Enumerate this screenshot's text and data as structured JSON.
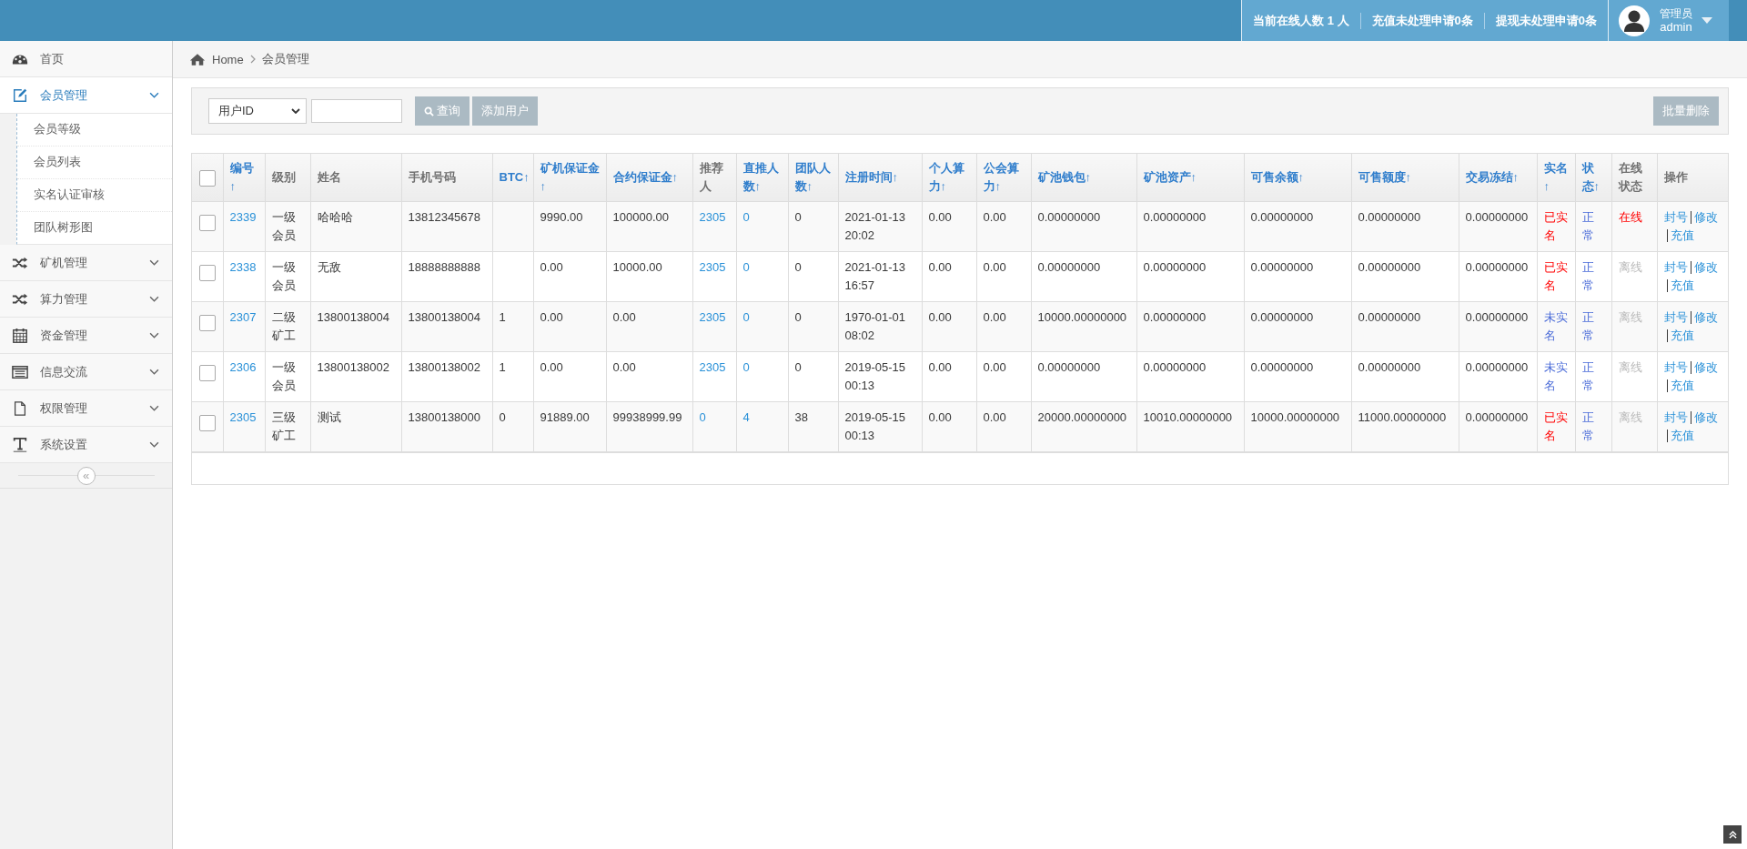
{
  "topbar": {
    "stats": [
      "当前在线人数 1 人",
      "充值未处理申请0条",
      "提现未处理申请0条"
    ],
    "user": {
      "role": "管理员",
      "name": "admin"
    }
  },
  "sidebar": {
    "items": [
      {
        "label": "首页"
      },
      {
        "label": "会员管理",
        "expanded": true,
        "children": [
          {
            "label": "会员等级"
          },
          {
            "label": "会员列表"
          },
          {
            "label": "实名认证审核"
          },
          {
            "label": "团队树形图"
          }
        ]
      },
      {
        "label": "矿机管理",
        "expanded": false
      },
      {
        "label": "算力管理",
        "expanded": false
      },
      {
        "label": "资金管理",
        "expanded": false
      },
      {
        "label": "信息交流",
        "expanded": false
      },
      {
        "label": "权限管理",
        "expanded": false
      },
      {
        "label": "系统设置",
        "expanded": false
      }
    ],
    "collapse": "«"
  },
  "breadcrumb": [
    "Home",
    "会员管理"
  ],
  "toolbar": {
    "filter": "用户ID",
    "search": "查询",
    "add": "添加用户",
    "bulk_delete": "批量删除"
  },
  "table": {
    "select_all_checked": false,
    "columns": [
      {
        "label": "编号↑",
        "sortable": true
      },
      {
        "label": "级别",
        "sortable": false
      },
      {
        "label": "姓名",
        "sortable": false
      },
      {
        "label": "手机号码",
        "sortable": false
      },
      {
        "label": "BTC↑",
        "sortable": true
      },
      {
        "label": "矿机保证金↑",
        "sortable": true
      },
      {
        "label": "合约保证金↑",
        "sortable": true
      },
      {
        "label": "推荐人",
        "sortable": false
      },
      {
        "label": "直推人数↑",
        "sortable": true
      },
      {
        "label": "团队人数↑",
        "sortable": true
      },
      {
        "label": "注册时间↑",
        "sortable": true
      },
      {
        "label": "个人算力↑",
        "sortable": true
      },
      {
        "label": "公会算力↑",
        "sortable": true
      },
      {
        "label": "矿池钱包↑",
        "sortable": true
      },
      {
        "label": "矿池资产↑",
        "sortable": true
      },
      {
        "label": "可售余额↑",
        "sortable": true
      },
      {
        "label": "可售额度↑",
        "sortable": true
      },
      {
        "label": "交易冻结↑",
        "sortable": true
      },
      {
        "label": "实名↑",
        "sortable": true
      },
      {
        "label": "状态↑",
        "sortable": true
      },
      {
        "label": "在线状态",
        "sortable": false
      },
      {
        "label": "操作",
        "sortable": false
      }
    ],
    "rows": [
      {
        "checked": false,
        "cells": [
          {
            "text": "2339",
            "kind": "link"
          },
          {
            "text": "一级会员",
            "kind": "text"
          },
          {
            "text": "哈哈哈",
            "kind": "text"
          },
          {
            "text": "13812345678",
            "kind": "text"
          },
          {
            "text": "",
            "kind": "text"
          },
          {
            "text": "9990.00",
            "kind": "text"
          },
          {
            "text": "100000.00",
            "kind": "text"
          },
          {
            "text": "2305",
            "kind": "link"
          },
          {
            "text": "0",
            "kind": "link"
          },
          {
            "text": "0",
            "kind": "text"
          },
          {
            "text": "2021-01-13 20:02",
            "kind": "text"
          },
          {
            "text": "0.00",
            "kind": "text"
          },
          {
            "text": "0.00",
            "kind": "text"
          },
          {
            "text": "0.00000000",
            "kind": "text"
          },
          {
            "text": "0.00000000",
            "kind": "text"
          },
          {
            "text": "0.00000000",
            "kind": "text"
          },
          {
            "text": "0.00000000",
            "kind": "text"
          },
          {
            "text": "0.00000000",
            "kind": "text"
          },
          {
            "text": "已实名",
            "kind": "alert"
          },
          {
            "text": "正常",
            "kind": "info"
          },
          {
            "text": "在线",
            "kind": "alert"
          }
        ],
        "actions": [
          "封号",
          "修改",
          "充值"
        ]
      },
      {
        "checked": false,
        "cells": [
          {
            "text": "2338",
            "kind": "link"
          },
          {
            "text": "一级会员",
            "kind": "text"
          },
          {
            "text": "无敌",
            "kind": "text"
          },
          {
            "text": "18888888888",
            "kind": "text"
          },
          {
            "text": "",
            "kind": "text"
          },
          {
            "text": "0.00",
            "kind": "text"
          },
          {
            "text": "10000.00",
            "kind": "text"
          },
          {
            "text": "2305",
            "kind": "link"
          },
          {
            "text": "0",
            "kind": "link"
          },
          {
            "text": "0",
            "kind": "text"
          },
          {
            "text": "2021-01-13 16:57",
            "kind": "text"
          },
          {
            "text": "0.00",
            "kind": "text"
          },
          {
            "text": "0.00",
            "kind": "text"
          },
          {
            "text": "0.00000000",
            "kind": "text"
          },
          {
            "text": "0.00000000",
            "kind": "text"
          },
          {
            "text": "0.00000000",
            "kind": "text"
          },
          {
            "text": "0.00000000",
            "kind": "text"
          },
          {
            "text": "0.00000000",
            "kind": "text"
          },
          {
            "text": "已实名",
            "kind": "alert"
          },
          {
            "text": "正常",
            "kind": "info"
          },
          {
            "text": "离线",
            "kind": "muted"
          }
        ],
        "actions": [
          "封号",
          "修改",
          "充值"
        ]
      },
      {
        "checked": false,
        "cells": [
          {
            "text": "2307",
            "kind": "link"
          },
          {
            "text": "二级矿工",
            "kind": "text"
          },
          {
            "text": "13800138004",
            "kind": "text"
          },
          {
            "text": "13800138004",
            "kind": "text"
          },
          {
            "text": "1",
            "kind": "text"
          },
          {
            "text": "0.00",
            "kind": "text"
          },
          {
            "text": "0.00",
            "kind": "text"
          },
          {
            "text": "2305",
            "kind": "link"
          },
          {
            "text": "0",
            "kind": "link"
          },
          {
            "text": "0",
            "kind": "text"
          },
          {
            "text": "1970-01-01 08:02",
            "kind": "text"
          },
          {
            "text": "0.00",
            "kind": "text"
          },
          {
            "text": "0.00",
            "kind": "text"
          },
          {
            "text": "10000.00000000",
            "kind": "text"
          },
          {
            "text": "0.00000000",
            "kind": "text"
          },
          {
            "text": "0.00000000",
            "kind": "text"
          },
          {
            "text": "0.00000000",
            "kind": "text"
          },
          {
            "text": "0.00000000",
            "kind": "text"
          },
          {
            "text": "未实名",
            "kind": "info"
          },
          {
            "text": "正常",
            "kind": "info"
          },
          {
            "text": "离线",
            "kind": "muted"
          }
        ],
        "actions": [
          "封号",
          "修改",
          "充值"
        ]
      },
      {
        "checked": false,
        "cells": [
          {
            "text": "2306",
            "kind": "link"
          },
          {
            "text": "一级会员",
            "kind": "text"
          },
          {
            "text": "13800138002",
            "kind": "text"
          },
          {
            "text": "13800138002",
            "kind": "text"
          },
          {
            "text": "1",
            "kind": "text"
          },
          {
            "text": "0.00",
            "kind": "text"
          },
          {
            "text": "0.00",
            "kind": "text"
          },
          {
            "text": "2305",
            "kind": "link"
          },
          {
            "text": "0",
            "kind": "link"
          },
          {
            "text": "0",
            "kind": "text"
          },
          {
            "text": "2019-05-15 00:13",
            "kind": "text"
          },
          {
            "text": "0.00",
            "kind": "text"
          },
          {
            "text": "0.00",
            "kind": "text"
          },
          {
            "text": "0.00000000",
            "kind": "text"
          },
          {
            "text": "0.00000000",
            "kind": "text"
          },
          {
            "text": "0.00000000",
            "kind": "text"
          },
          {
            "text": "0.00000000",
            "kind": "text"
          },
          {
            "text": "0.00000000",
            "kind": "text"
          },
          {
            "text": "未实名",
            "kind": "info"
          },
          {
            "text": "正常",
            "kind": "info"
          },
          {
            "text": "离线",
            "kind": "muted"
          }
        ],
        "actions": [
          "封号",
          "修改",
          "充值"
        ]
      },
      {
        "checked": false,
        "cells": [
          {
            "text": "2305",
            "kind": "link"
          },
          {
            "text": "三级矿工",
            "kind": "text"
          },
          {
            "text": "测试",
            "kind": "text"
          },
          {
            "text": "13800138000",
            "kind": "text"
          },
          {
            "text": "0",
            "kind": "text"
          },
          {
            "text": "91889.00",
            "kind": "text"
          },
          {
            "text": "99938999.99",
            "kind": "text"
          },
          {
            "text": "0",
            "kind": "link"
          },
          {
            "text": "4",
            "kind": "link"
          },
          {
            "text": "38",
            "kind": "text"
          },
          {
            "text": "2019-05-15 00:13",
            "kind": "text"
          },
          {
            "text": "0.00",
            "kind": "text"
          },
          {
            "text": "0.00",
            "kind": "text"
          },
          {
            "text": "20000.00000000",
            "kind": "text"
          },
          {
            "text": "10010.00000000",
            "kind": "text"
          },
          {
            "text": "10000.00000000",
            "kind": "text"
          },
          {
            "text": "11000.00000000",
            "kind": "text"
          },
          {
            "text": "0.00000000",
            "kind": "text"
          },
          {
            "text": "已实名",
            "kind": "alert"
          },
          {
            "text": "正常",
            "kind": "info"
          },
          {
            "text": "离线",
            "kind": "muted"
          }
        ],
        "actions": [
          "封号",
          "修改",
          "充值"
        ]
      }
    ]
  }
}
